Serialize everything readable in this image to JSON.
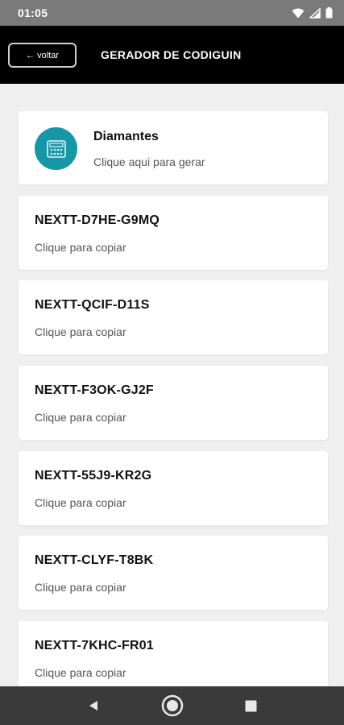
{
  "status_bar": {
    "time": "01:05"
  },
  "app_bar": {
    "back_label": "← voltar",
    "title": "GERADOR DE CODIGUIN"
  },
  "header_card": {
    "title": "Diamantes",
    "subtitle": "Clique aqui para gerar",
    "icon": "calculator-icon",
    "icon_bg": "#1697a8"
  },
  "codes": [
    {
      "code": "NEXTT-D7HE-G9MQ",
      "action": "Clique para copiar"
    },
    {
      "code": "NEXTT-QCIF-D11S",
      "action": "Clique para copiar"
    },
    {
      "code": "NEXTT-F3OK-GJ2F",
      "action": "Clique para copiar"
    },
    {
      "code": "NEXTT-55J9-KR2G",
      "action": "Clique para copiar"
    },
    {
      "code": "NEXTT-CLYF-T8BK",
      "action": "Clique para copiar"
    },
    {
      "code": "NEXTT-7KHC-FR01",
      "action": "Clique para copiar"
    }
  ],
  "nav_bar": {
    "back": "back-icon",
    "home": "home-icon",
    "recents": "recents-icon"
  }
}
